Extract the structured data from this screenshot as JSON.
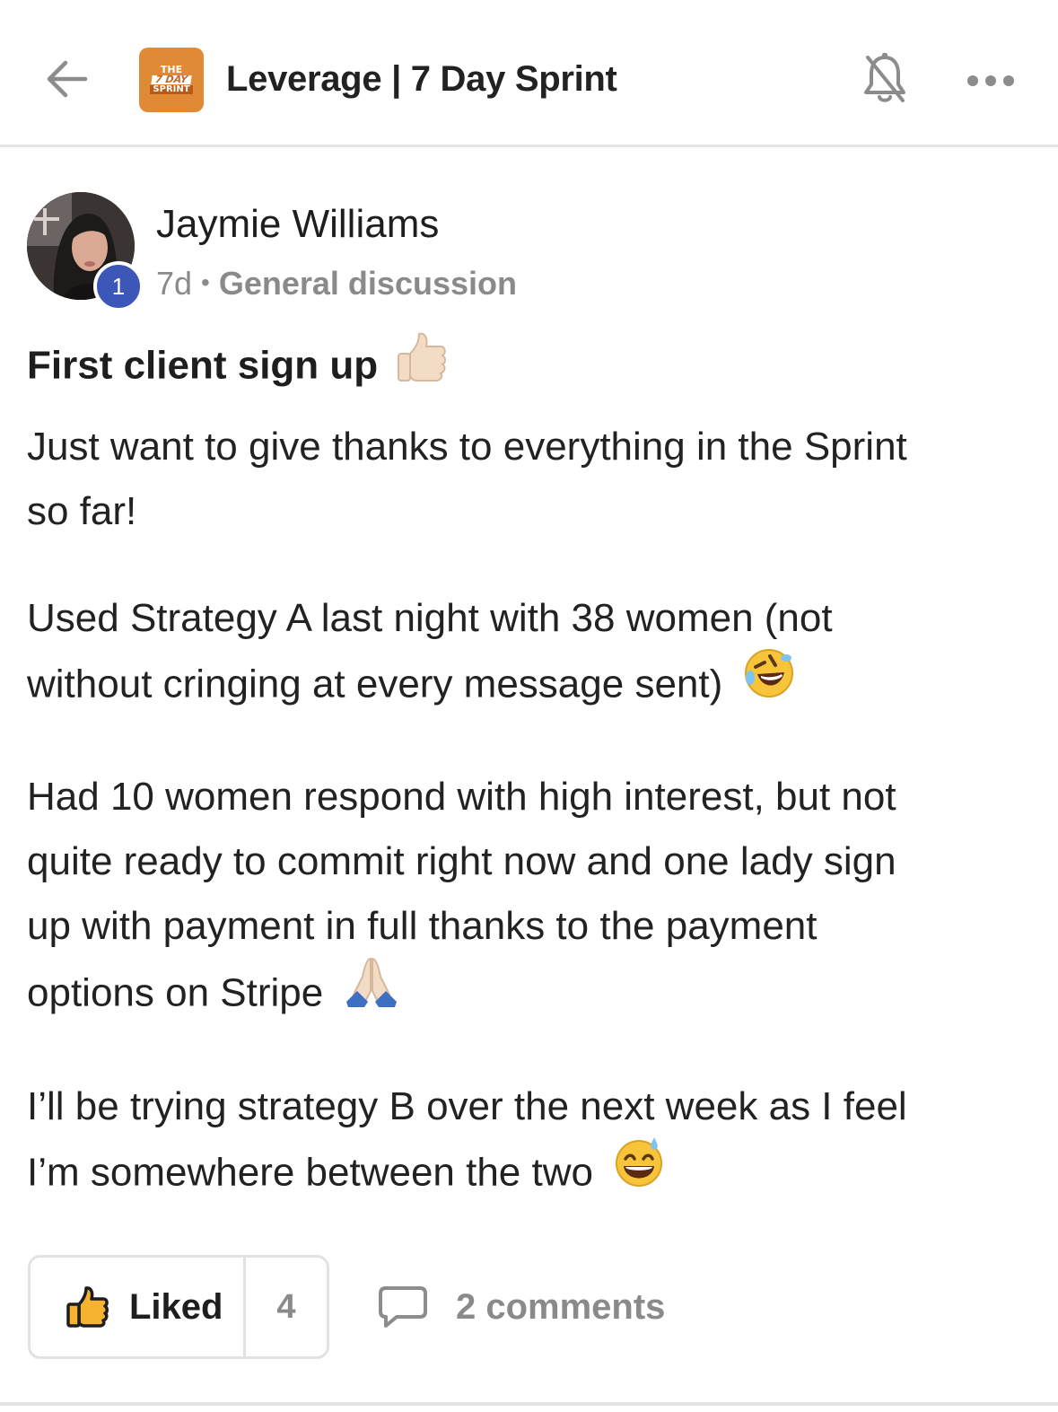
{
  "header": {
    "title": "Leverage | 7 Day Sprint",
    "logo_lines": [
      "THE",
      "7 DAY",
      "SPRINT"
    ],
    "back_icon": "arrow-left-icon",
    "bell_icon": "bell-off-icon",
    "more_icon": "more-horizontal-icon"
  },
  "author": {
    "name": "Jaymie Williams",
    "level": "1",
    "time_ago": "7d",
    "category": "General discussion"
  },
  "post": {
    "title": "First client sign up",
    "paragraphs": [
      [
        "Just want to give thanks to everything in the Sprint",
        "so far!"
      ],
      [
        "Used Strategy A last night with 38 women (not",
        "without cringing at every message sent)"
      ],
      [
        "Had 10 women respond with high interest, but not",
        "quite ready to commit right now and one lady sign",
        "up with payment in full thanks to the payment",
        "options on Stripe"
      ],
      [
        "I’ll be trying strategy B over the next week as I feel",
        "I’m somewhere between the two"
      ]
    ]
  },
  "actions": {
    "like_label": "Liked",
    "like_count": "4",
    "comments_label": "2 comments"
  },
  "colors": {
    "logo_orange": "#e08a35",
    "badge_blue": "#3c57b8",
    "muted_text": "#8a8a8a",
    "border": "#e2e2e2"
  }
}
